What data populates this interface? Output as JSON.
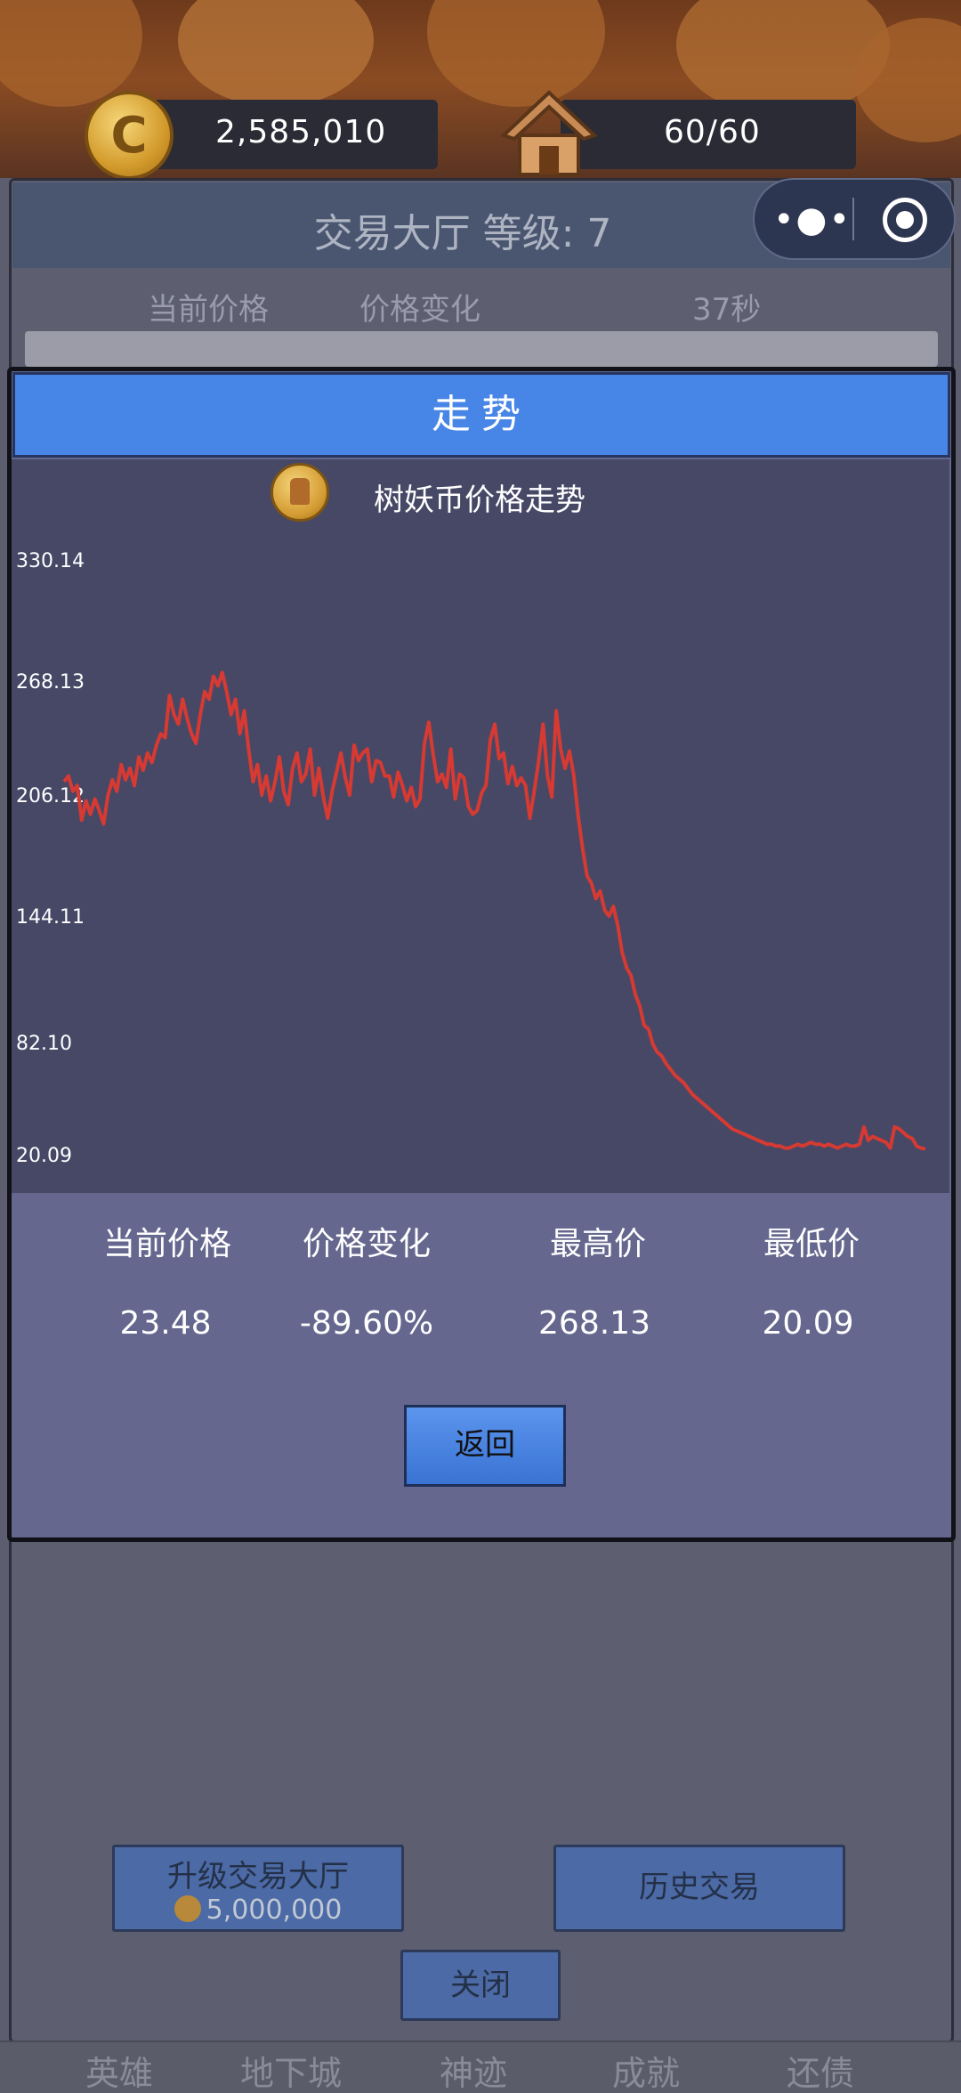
{
  "resources": {
    "coins": "2,585,010",
    "capacity": "60/60",
    "coin_glyph": "C"
  },
  "background_panel": {
    "title": "交易大厅 等级: 7",
    "columns": [
      "当前价格",
      "价格变化",
      "37秒"
    ],
    "upgrade_label": "升级交易大厅",
    "upgrade_cost": "5,000,000",
    "history_label": "历史交易",
    "close_label": "关闭"
  },
  "capsule": {
    "more_glyph": "•●•"
  },
  "tabs": [
    "英雄",
    "地下城",
    "神迹",
    "成就",
    "还债"
  ],
  "modal": {
    "title": "走势",
    "chart_title": "树妖币价格走势",
    "stats": {
      "labels": [
        "当前价格",
        "价格变化",
        "最高价",
        "最低价"
      ],
      "values": [
        "23.48",
        "-89.60%",
        "268.13",
        "20.09"
      ]
    },
    "back_label": "返回"
  },
  "colors": {
    "line": "#d63a32",
    "header_blue": "#4785e6",
    "chart_bg": "#464866"
  },
  "chart_data": {
    "type": "line",
    "title": "树妖币价格走势",
    "y_ticks": [
      "330.14",
      "268.13",
      "206.12",
      "144.11",
      "82.10",
      "20.09"
    ],
    "ylim": [
      20.09,
      330.14
    ],
    "grid": false,
    "series": [
      {
        "values": [
          215,
          218,
          210,
          213,
          195,
          205,
          198,
          206,
          200,
          193,
          208,
          216,
          210,
          224,
          216,
          222,
          213,
          228,
          221,
          230,
          225,
          234,
          240,
          238,
          260,
          250,
          245,
          258,
          248,
          240,
          235,
          250,
          262,
          258,
          270,
          265,
          272,
          262,
          250,
          258,
          240,
          252,
          232,
          215,
          224,
          208,
          218,
          205,
          215,
          228,
          210,
          203,
          222,
          230,
          215,
          219,
          232,
          208,
          222,
          207,
          196,
          210,
          220,
          230,
          217,
          208,
          234,
          226,
          230,
          232,
          215,
          226,
          225,
          218,
          218,
          207,
          220,
          213,
          205,
          212,
          202,
          206,
          235,
          246,
          229,
          215,
          219,
          212,
          232,
          206,
          219,
          217,
          202,
          198,
          200,
          209,
          213,
          237,
          245,
          227,
          230,
          214,
          223,
          213,
          217,
          213,
          196,
          210,
          226,
          245,
          218,
          207,
          252,
          232,
          222,
          231,
          218,
          197,
          180,
          166,
          162,
          154,
          158,
          148,
          145,
          150,
          140,
          126,
          118,
          114,
          104,
          98,
          88,
          86,
          78,
          74,
          72,
          68,
          65,
          62,
          60,
          58,
          55,
          52,
          50,
          48,
          46,
          44,
          42,
          40,
          38,
          36,
          34,
          33,
          32,
          31,
          30,
          29,
          28,
          27,
          26,
          26,
          25,
          25,
          24,
          24,
          25,
          26,
          25,
          26,
          27,
          26,
          26,
          25,
          26,
          25,
          24,
          25,
          26,
          25,
          25,
          26,
          35,
          28,
          30,
          29,
          28,
          27,
          24,
          35,
          34,
          32,
          30,
          29,
          25,
          24,
          23.48
        ]
      }
    ]
  }
}
